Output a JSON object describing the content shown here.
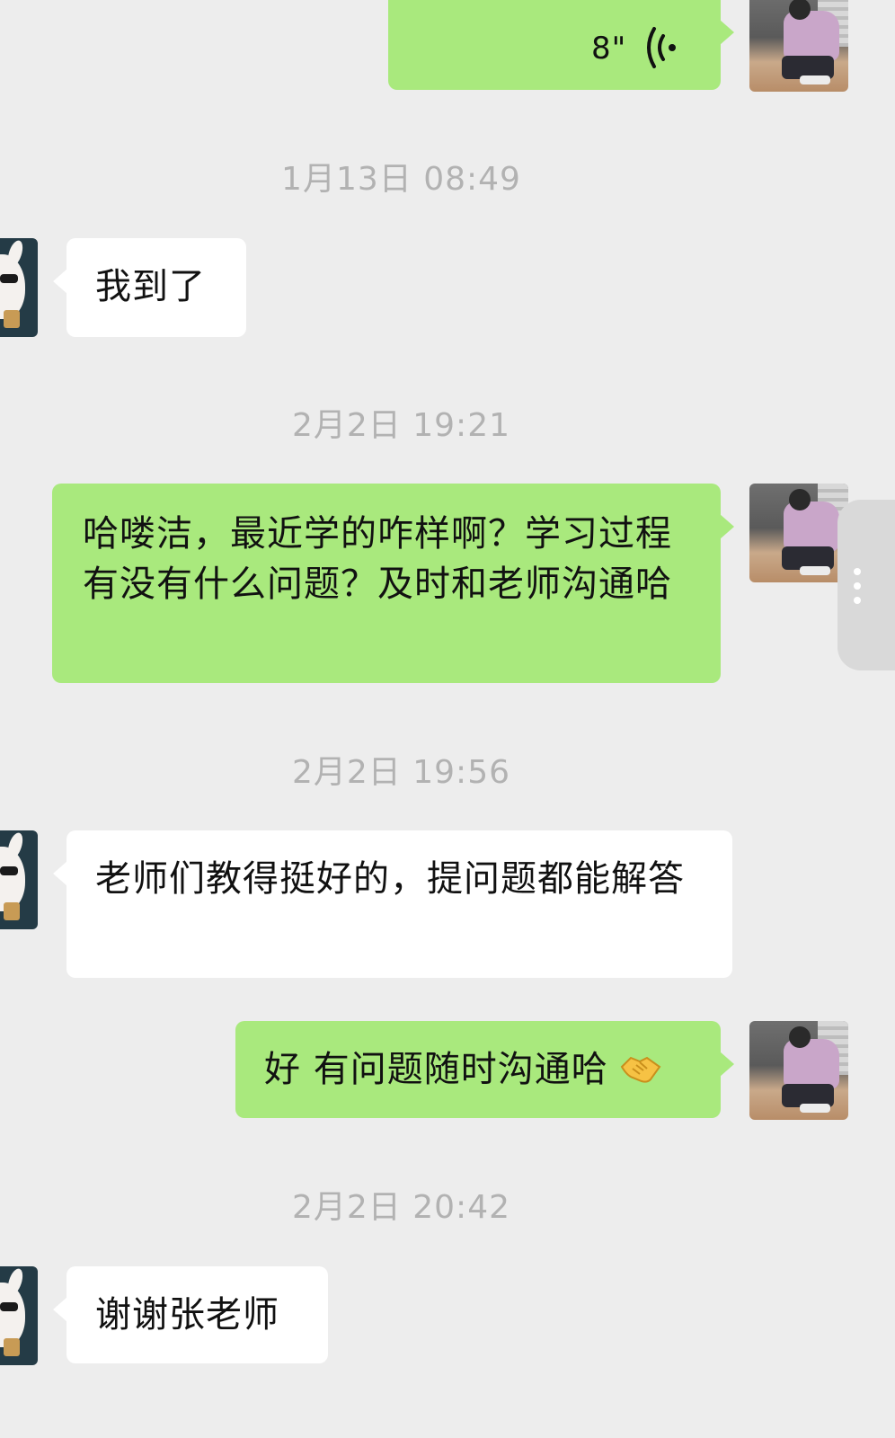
{
  "messages": [
    {
      "side": "right",
      "type": "voice",
      "duration": "8\""
    },
    {
      "type": "timestamp",
      "text": "1月13日 08:49"
    },
    {
      "side": "left",
      "type": "text",
      "text": "我到了"
    },
    {
      "type": "timestamp",
      "text": "2月2日 19:21"
    },
    {
      "side": "right",
      "type": "text",
      "text": "哈喽洁，最近学的咋样啊？学习过程有没有什么问题？及时和老师沟通哈"
    },
    {
      "type": "timestamp",
      "text": "2月2日 19:56"
    },
    {
      "side": "left",
      "type": "text",
      "text": "老师们教得挺好的，提问题都能解答"
    },
    {
      "side": "right",
      "type": "text",
      "text": "好 有问题随时沟通哈",
      "emoji": "handshake-icon"
    },
    {
      "type": "timestamp",
      "text": "2月2日 20:42"
    },
    {
      "side": "left",
      "type": "text",
      "text": "谢谢张老师"
    }
  ],
  "colors": {
    "background": "#ededed",
    "sent_bubble": "#a9e97d",
    "received_bubble": "#ffffff",
    "timestamp": "#b2b2b2"
  }
}
